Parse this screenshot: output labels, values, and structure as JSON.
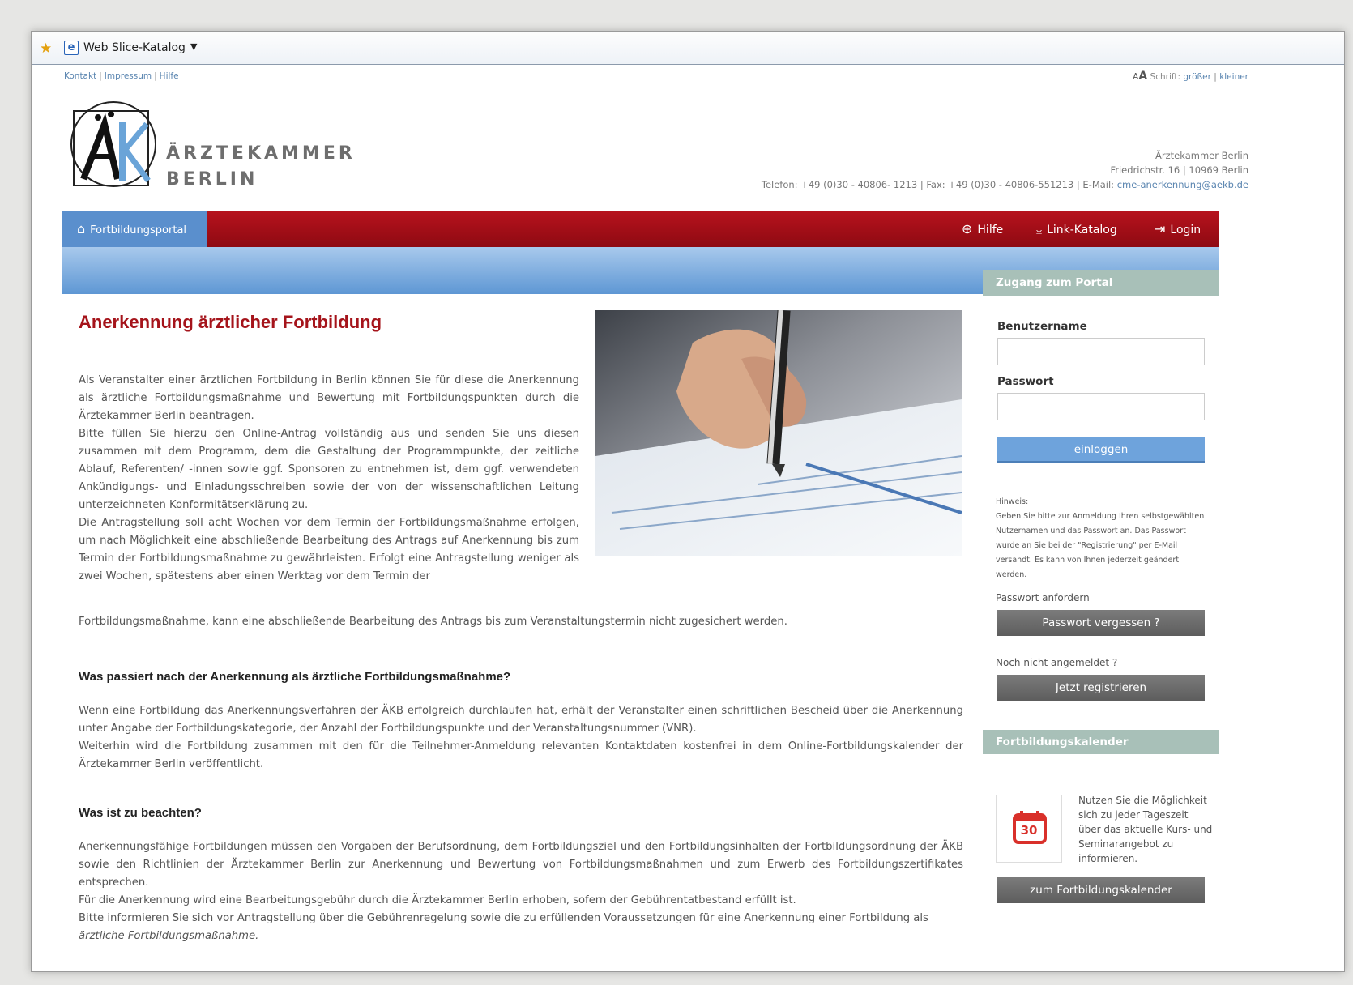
{
  "favorites_bar": {
    "web_slice_label": "Web Slice-Katalog"
  },
  "top_links": {
    "kontakt": "Kontakt",
    "impressum": "Impressum",
    "hilfe": "Hilfe",
    "separator": "|"
  },
  "font_size": {
    "small_a": "A",
    "big_a": "A",
    "label": "Schrift:",
    "bigger": "größer",
    "smaller": "kleiner",
    "separator": "|"
  },
  "logo": {
    "line1": "ÄRZTEKAMMER",
    "line2": "BERLIN"
  },
  "address": {
    "name": "Ärztekammer Berlin",
    "street": "Friedrichstr. 16 | 10969 Berlin",
    "contact": "Telefon: +49 (0)30 - 40806- 1213 | Fax: +49 (0)30 - 40806-551213 | E-Mail: ",
    "email": "cme-anerkennung@aekb.de"
  },
  "nav": {
    "portal": "Fortbildungsportal",
    "help": "Hilfe",
    "link_catalog": "Link-Katalog",
    "login": "Login"
  },
  "main": {
    "title": "Anerkennung ärztlicher Fortbildung",
    "intro1": "Als Veranstalter einer ärztlichen Fortbildung in Berlin können Sie für diese die Anerkennung als ärztliche Fortbildungsmaßnahme und Bewertung mit Fortbildungspunkten durch die Ärztekammer Berlin beantragen.",
    "intro2": "Bitte füllen Sie hierzu den Online-Antrag vollständig aus und senden Sie uns diesen zusammen mit dem Programm, dem die Gestaltung der Programmpunkte, der zeitliche Ablauf, Referenten/ -innen sowie ggf. Sponsoren zu entnehmen ist, dem ggf. verwendeten Ankündigungs- und Einladungsschreiben sowie der von der wissenschaftlichen Leitung unterzeichneten Konformitätserklärung zu.",
    "intro3": "Die Antragstellung soll acht Wochen vor dem Termin der Fortbildungsmaßnahme erfolgen, um nach Möglichkeit eine abschließende Bearbeitung des Antrags auf Anerkennung bis zum Termin der Fortbildungsmaßnahme zu gewährleisten. Erfolgt eine Antragstellung weniger als zwei Wochen, spätestens aber einen Werktag vor dem Termin der",
    "intro3_last": "Fortbildungsmaßnahme, kann eine abschließende Bearbeitung des Antrags bis zum Veranstaltungstermin nicht zugesichert werden.",
    "h2_after": "Was passiert nach der Anerkennung als ärztliche Fortbildungsmaßnahme?",
    "after1": "Wenn eine Fortbildung das Anerkennungsverfahren der ÄKB erfolgreich durchlaufen hat, erhält der Veranstalter einen schriftlichen Bescheid über die Anerkennung unter Angabe der Fortbildungskategorie, der Anzahl der Fortbildungspunkte und der Veranstaltungsnummer (VNR).",
    "after2": "Weiterhin wird die Fortbildung zusammen mit den für die Teilnehmer-Anmeldung relevanten Kontaktdaten kostenfrei in dem Online-Fortbildungskalender der Ärztekammer Berlin veröffentlicht.",
    "h2_note": "Was ist zu beachten?",
    "note1": "Anerkennungsfähige Fortbildungen müssen den Vorgaben der Berufsordnung, dem Fortbildungsziel und den Fortbildungsinhalten der Fortbildungsordnung der ÄKB sowie den Richtlinien der Ärztekammer Berlin zur Anerkennung und Bewertung von Fortbildungsmaßnahmen und zum Erwerb des Fortbildungszertifikates entsprechen.",
    "note2": "Für die Anerkennung wird eine Bearbeitungsgebühr durch die Ärztekammer Berlin erhoben, sofern der Gebührentatbestand erfüllt ist.",
    "note3": "Bitte informieren Sie sich vor Antragstellung über die Gebührenregelung sowie die zu erfüllenden Voraussetzungen für eine Anerkennung einer Fortbildung als",
    "note3_ital": "ärztliche Fortbildungsmaßnahme."
  },
  "sidebar": {
    "portal_header": "Zugang zum Portal",
    "username_label": "Benutzername",
    "username_value": "",
    "password_label": "Passwort",
    "password_value": "",
    "login_button": "einloggen",
    "hint_title": "Hinweis:",
    "hint_text": "Geben Sie bitte zur Anmeldung Ihren selbstgewählten Nutzernamen und das Passwort an. Das Passwort wurde an Sie bei der \"Registrierung\" per E-Mail versandt. Es kann von Ihnen jederzeit geändert werden.",
    "request_password_label": "Passwort anfordern",
    "forgot_button": "Passwort vergessen ?",
    "not_registered_label": "Noch nicht angemeldet ?",
    "register_button": "Jetzt registrieren",
    "calendar_header": "Fortbildungskalender",
    "calendar_day": "30",
    "calendar_text": "Nutzen Sie die Möglichkeit sich zu jeder Tageszeit über das aktuelle Kurs- und Seminarangebot zu informieren.",
    "calendar_button": "zum Fortbildungskalender"
  },
  "colors": {
    "nav_red": "#a5141b",
    "nav_blue": "#5a8fcd",
    "sidebar_header": "#a8c0b8",
    "link_blue": "#5a85b0"
  }
}
